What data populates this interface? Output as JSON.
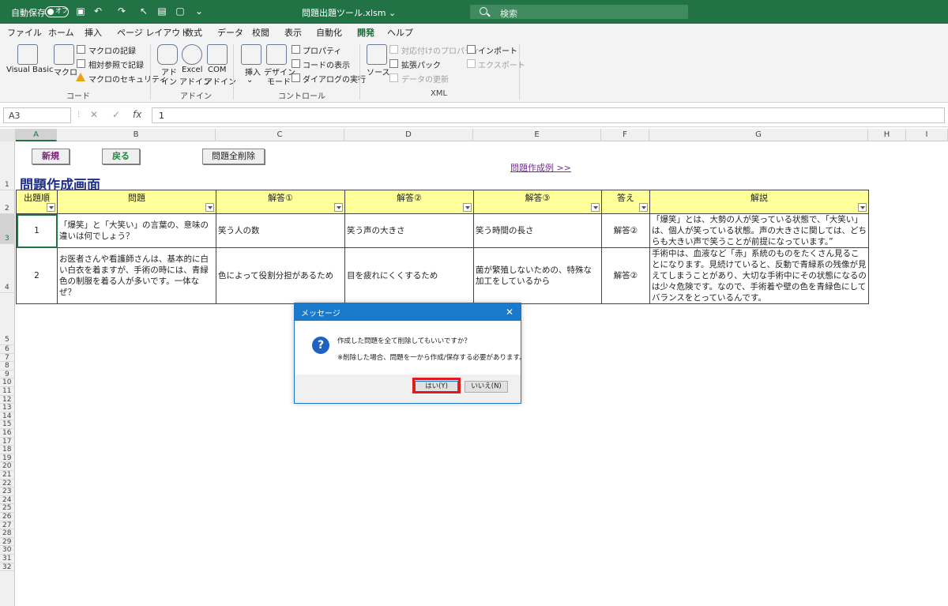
{
  "titlebar": {
    "autosave_label": "自動保存",
    "autosave_state": "オフ",
    "filename": "問題出題ツール.xlsm",
    "search_placeholder": "検索",
    "bg_color": "#217346"
  },
  "tabs": [
    "ファイル",
    "ホーム",
    "挿入",
    "ページ レイアウト",
    "数式",
    "データ",
    "校閲",
    "表示",
    "自動化",
    "開発",
    "ヘルプ"
  ],
  "active_tab": "開発",
  "ribbon": {
    "code": {
      "visual_basic": "Visual Basic",
      "macro": "マクロ",
      "record_macro": "マクロの記録",
      "relative_ref": "相対参照で記録",
      "macro_security": "マクロのセキュリティ",
      "group": "コード"
    },
    "addins": {
      "addin_1": "アド",
      "addin_2": "イン",
      "excel_addin_1": "Excel",
      "excel_addin_2": "アドイン",
      "com_addin_1": "COM",
      "com_addin_2": "アドイン",
      "group": "アドイン"
    },
    "controls": {
      "insert": "挿入",
      "design_mode_1": "デザイン",
      "design_mode_2": "モード",
      "properties": "プロパティ",
      "view_code": "コードの表示",
      "run_dialog": "ダイアログの実行",
      "group": "コントロール"
    },
    "xml": {
      "source": "ソース",
      "map_properties": "対応付けのプロパティ",
      "expansion_packs": "拡張パック",
      "refresh_data": "データの更新",
      "import": "インポート",
      "export": "エクスポート",
      "group": "XML"
    }
  },
  "formulabar": {
    "namebox": "A3",
    "fx": "fx",
    "value": "1"
  },
  "columns": [
    "A",
    "B",
    "C",
    "D",
    "E",
    "F",
    "G",
    "H",
    "I"
  ],
  "rows": [
    "1",
    "2",
    "3",
    "4",
    "5",
    "6",
    "7",
    "8",
    "9",
    "10",
    "11",
    "12",
    "13",
    "14",
    "15",
    "16",
    "17",
    "18",
    "19",
    "20",
    "21",
    "22",
    "23",
    "24",
    "25",
    "26",
    "27",
    "28",
    "29",
    "30",
    "31",
    "32"
  ],
  "sheet": {
    "btn_new": "新規",
    "btn_back": "戻る",
    "btn_delete_all": "問題全削除",
    "title": "問題作成画面",
    "example_link": "問題作成例 >>",
    "headers": [
      "出題順",
      "問題",
      "解答①",
      "解答②",
      "解答③",
      "答え",
      "解説"
    ],
    "rows": [
      {
        "order": "1",
        "question": "「爆笑」と「大笑い」の言葉の、意味の違いは何でしょう？",
        "ans1": "笑う人の数",
        "ans2": "笑う声の大きさ",
        "ans3": "笑う時間の長さ",
        "answer": "解答②",
        "explanation": "「爆笑」とは、大勢の人が笑っている状態で、「大笑い」は、個人が笑っている状態。声の大きさに関しては、どちらも大きい声で笑うことが前提になっています。”"
      },
      {
        "order": "2",
        "question": "お医者さんや看護師さんは、基本的に白い白衣を着ますが、手術の時には、青緑色の制服を着る人が多いです。一体なぜ？",
        "ans1": "色によって役割分担があるため",
        "ans2": "目を疲れにくくするため",
        "ans3": "菌が繁殖しないための、特殊な加工をしているから",
        "answer": "解答②",
        "explanation": "手術中は、血液など「赤」系統のものをたくさん見ることになります。見続けていると、反動で青緑系の残像が見えてしまうことがあり、大切な手術中にその状態になるのは少々危険です。なので、手術着や壁の色を青緑色にしてバランスをとっているんです。"
      }
    ]
  },
  "dialog": {
    "title": "メッセージ",
    "message": "作成した問題を全て削除してもいいですか？",
    "note": "※削除した場合、問題を一から作成/保存する必要があります。",
    "yes": "はい(Y)",
    "no": "いいえ(N)",
    "highlight_color": "#e01b1b"
  }
}
